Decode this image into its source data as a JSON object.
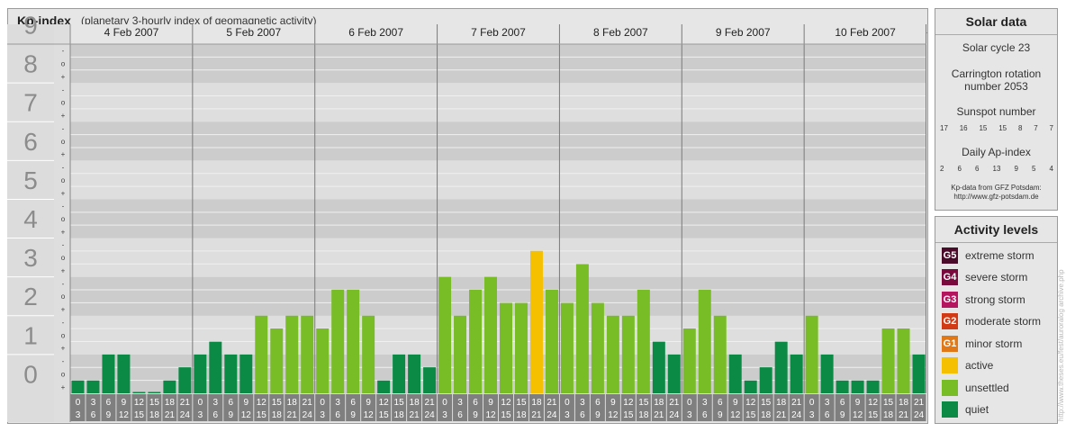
{
  "title": {
    "main": "Kp-index",
    "subtitle": "(planetary 3-hourly index of geomagnetic activity)"
  },
  "solar": {
    "title": "Solar data",
    "cycle": "Solar cycle 23",
    "carrington_1": "Carrington rotation",
    "carrington_2": "number 2053",
    "sunspot_label": "Sunspot number",
    "sunspot": [
      "17",
      "16",
      "15",
      "15",
      "8",
      "7",
      "7"
    ],
    "ap_label": "Daily Ap-index",
    "ap": [
      "2",
      "6",
      "6",
      "13",
      "9",
      "5",
      "4"
    ],
    "source_1": "Kp-data from GFZ Potsdam:",
    "source_2": "http://www.gfz-potsdam.de"
  },
  "levels": {
    "title": "Activity levels",
    "items": [
      {
        "code": "G5",
        "label": "extreme storm",
        "color": "#4a0a2a"
      },
      {
        "code": "G4",
        "label": "severe storm",
        "color": "#7a0a3e"
      },
      {
        "code": "G3",
        "label": "strong storm",
        "color": "#b5145e"
      },
      {
        "code": "G2",
        "label": "moderate storm",
        "color": "#d13a14"
      },
      {
        "code": "G1",
        "label": "minor storm",
        "color": "#e07818"
      },
      {
        "code": "",
        "label": "active",
        "color": "#f5c000"
      },
      {
        "code": "",
        "label": "unsettled",
        "color": "#78bc26"
      },
      {
        "code": "",
        "label": "quiet",
        "color": "#0b8a45"
      }
    ]
  },
  "watermark": "http://www.theses.eu/fest/auroralog archive.php",
  "chart_data": {
    "type": "bar",
    "title": "Kp-index",
    "ylim": [
      0,
      9
    ],
    "y_ticks": [
      "0",
      "1",
      "2",
      "3",
      "4",
      "5",
      "6",
      "7",
      "8",
      "9"
    ],
    "sub_ticks": [
      "+",
      "o",
      "-"
    ],
    "days": [
      "4 Feb 2007",
      "5 Feb 2007",
      "6 Feb 2007",
      "7 Feb 2007",
      "8 Feb 2007",
      "9 Feb 2007",
      "10 Feb 2007"
    ],
    "hour_starts": [
      "0",
      "3",
      "6",
      "9",
      "12",
      "15",
      "18",
      "21"
    ],
    "hour_ends": [
      "3",
      "6",
      "9",
      "12",
      "15",
      "18",
      "21",
      "24"
    ],
    "values": [
      [
        0.33,
        0.33,
        1.0,
        1.0,
        0.0,
        0.0,
        0.33,
        0.67
      ],
      [
        1.0,
        1.33,
        1.0,
        1.0,
        2.0,
        1.67,
        2.0,
        2.0
      ],
      [
        1.67,
        2.67,
        2.67,
        2.0,
        0.33,
        1.0,
        1.0,
        0.67
      ],
      [
        3.0,
        2.0,
        2.67,
        3.0,
        2.33,
        2.33,
        3.67,
        2.67
      ],
      [
        2.33,
        3.33,
        2.33,
        2.0,
        2.0,
        2.67,
        1.33,
        1.0
      ],
      [
        1.67,
        2.67,
        2.0,
        1.0,
        0.33,
        0.67,
        1.33,
        1.0
      ],
      [
        2.0,
        1.0,
        0.33,
        0.33,
        0.33,
        1.67,
        1.67,
        1.0
      ]
    ],
    "colors": {
      "quiet": "#0b8a45",
      "unsettled": "#78bc26",
      "active": "#f5c000"
    }
  }
}
